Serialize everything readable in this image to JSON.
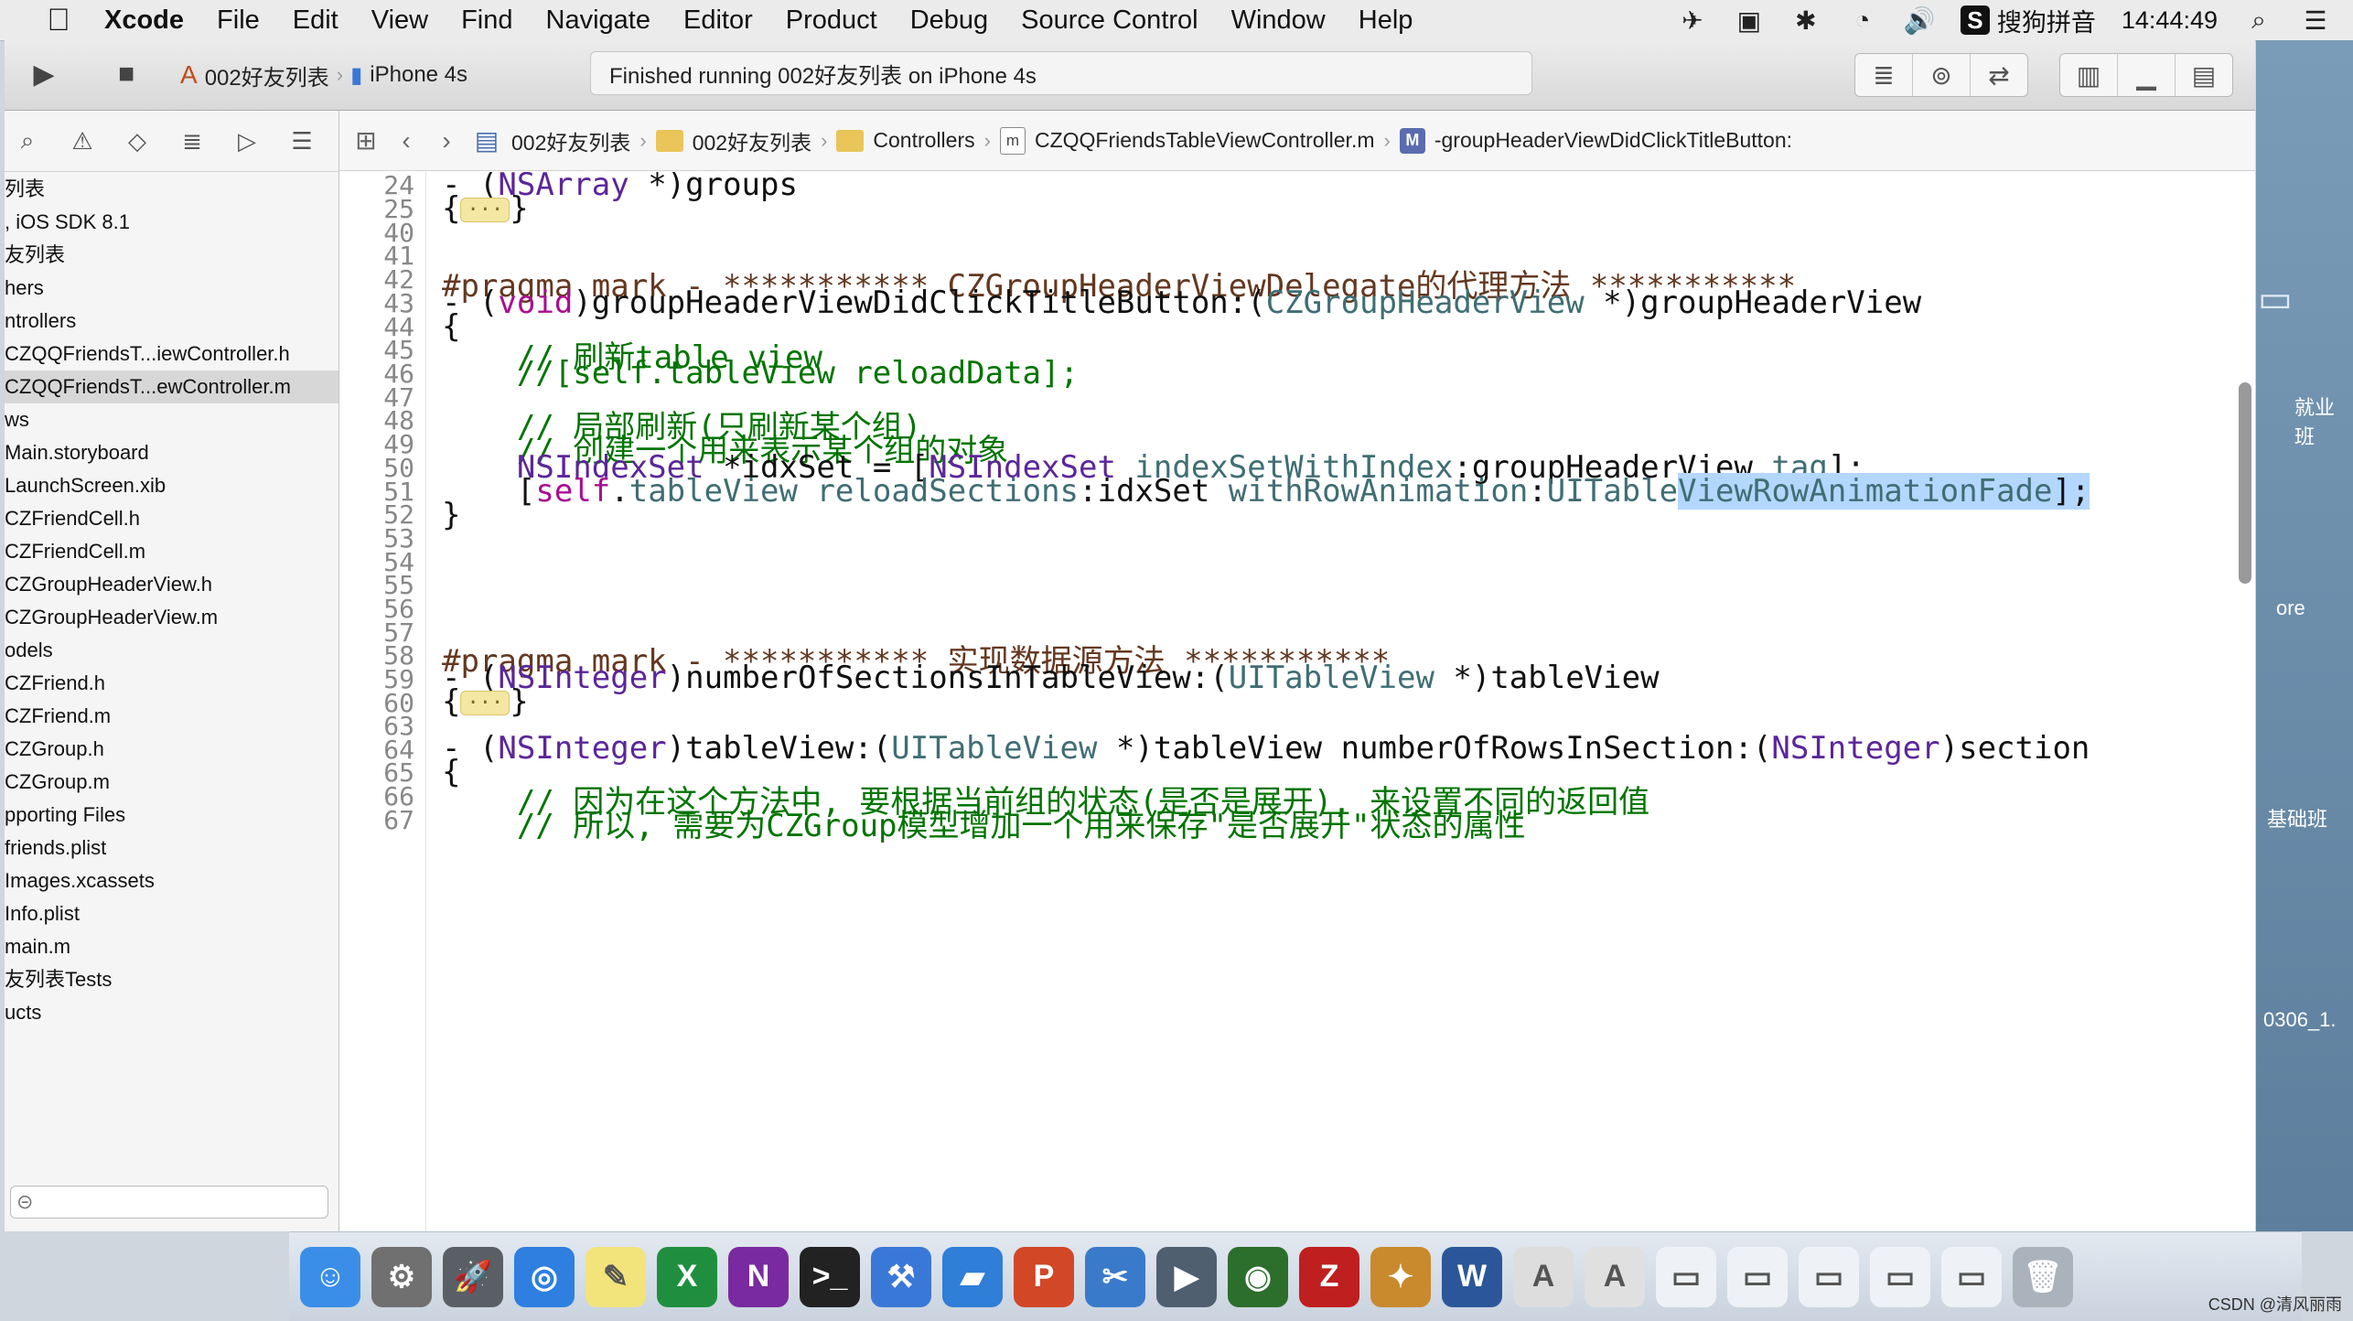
{
  "menubar": {
    "apple": "",
    "items": [
      "Xcode",
      "File",
      "Edit",
      "View",
      "Find",
      "Navigate",
      "Editor",
      "Product",
      "Debug",
      "Source Control",
      "Window",
      "Help"
    ],
    "ime": "搜狗拼音",
    "time": "14:44:49"
  },
  "toolbar": {
    "scheme": "002好友列表",
    "device": "iPhone 4s",
    "status": "Finished running 002好友列表 on iPhone 4s"
  },
  "navigator": {
    "items": [
      "列表",
      ", iOS SDK 8.1",
      "友列表",
      "hers",
      "ntrollers",
      "CZQQFriendsT...iewController.h",
      "CZQQFriendsT...ewController.m",
      "ws",
      "Main.storyboard",
      "LaunchScreen.xib",
      "CZFriendCell.h",
      "CZFriendCell.m",
      "CZGroupHeaderView.h",
      "CZGroupHeaderView.m",
      "odels",
      "CZFriend.h",
      "CZFriend.m",
      "CZGroup.h",
      "CZGroup.m",
      "pporting Files",
      "friends.plist",
      "Images.xcassets",
      "Info.plist",
      "main.m",
      "友列表Tests",
      "ucts"
    ],
    "selected_index": 6
  },
  "jumpbar": {
    "project": "002好友列表",
    "group": "002好友列表",
    "folder": "Controllers",
    "file": "CZQQFriendsTableViewController.m",
    "method": "-groupHeaderViewDidClickTitleButton:",
    "file_badge": "m",
    "method_badge": "M"
  },
  "editor": {
    "line_numbers": [
      "24",
      "25",
      "40",
      "41",
      "42",
      "43",
      "44",
      "45",
      "46",
      "47",
      "48",
      "49",
      "50",
      "51",
      "52",
      "53",
      "54",
      "55",
      "56",
      "57",
      "58",
      "59",
      "60",
      "63",
      "64",
      "65",
      "66",
      "67"
    ]
  },
  "desktop": {
    "labels": [
      "就业班",
      "ore",
      "基础班",
      "0306_1."
    ]
  },
  "dock": {
    "icons": [
      "finder-icon",
      "system-preferences-icon",
      "launchpad-icon",
      "safari-icon",
      "notes-icon",
      "excel-icon",
      "onenote-icon",
      "terminal-icon",
      "xcode-icon",
      "folder-icon",
      "powerpoint-icon",
      "snipping-icon",
      "imovie-icon",
      "network-icon",
      "filezilla-icon",
      "tools-icon",
      "word-icon",
      "app-icon",
      "app-icon-2",
      "window-icon",
      "window-icon-2",
      "window-icon-3",
      "window-icon-4",
      "window-icon-5",
      "trash-icon"
    ]
  },
  "watermark": "CSDN @清风丽雨"
}
